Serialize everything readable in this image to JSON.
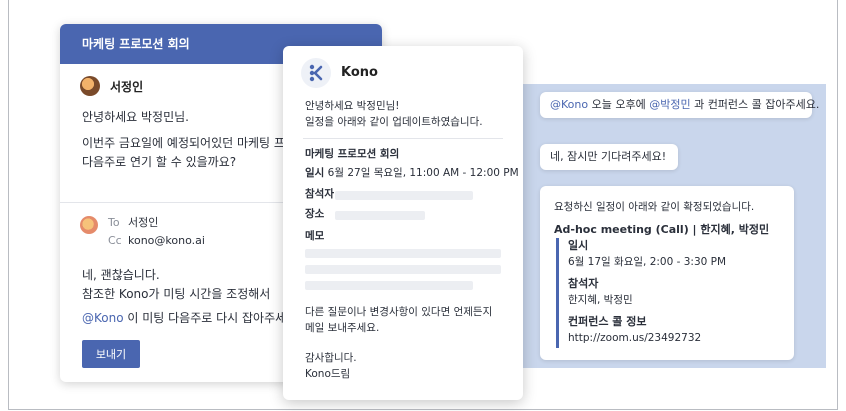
{
  "email": {
    "header_title": "마케팅 프로모션 회의",
    "sender_name": "서정인",
    "body_line1": "안녕하세요 박정민님.",
    "body_line2": "이번주 금요일에 예정되어있던 마케팅 프",
    "body_line3": "다음주로 연기 할 수 있을까요?",
    "to_label": "To",
    "to_value": "서정인",
    "cc_label": "Cc",
    "cc_value": "kono@kono.ai",
    "reply_line1": "네, 괜찮습니다.",
    "reply_line2": "참조한 Kono가 미팅 시간을 조정해서 ",
    "reply_line3_tail": "이 미팅 다음주로 다시 잡아주세",
    "mention": "@Kono",
    "send_label": "보내기"
  },
  "kono": {
    "app_name": "Kono",
    "greeting": "안녕하세요 박정민님!",
    "update_msg": "일정을 아래와 같이 업데이트하였습니다.",
    "meeting_title": "마케팅 프로모션 회의",
    "date_label": "일시",
    "date_value": "6월 27일 목요일, 11:00 AM - 12:00 PM",
    "attendee_label": "참석자",
    "place_label": "장소",
    "memo_label": "메모",
    "closing_line1": "다른 질문이나 변경사항이 있다면 언제든지",
    "closing_line2": "메일 보내주세요.",
    "thanks": "감사합니다.",
    "sign": "Kono드림"
  },
  "chat": {
    "msg1_mention1": "@Kono",
    "msg1_mid": " 오늘 오후에 ",
    "msg1_mention2": "@박정민",
    "msg1_end": " 과 컨퍼런스 콜 잡아주세요.",
    "msg2": "네, 잠시만 기다려주세요!",
    "confirm_intro": "요청하신 일정이 아래와 같이 확정되었습니다.",
    "confirm_title": "Ad-hoc meeting (Call) | 한지혜, 박정민",
    "date_label": "일시",
    "date_value": "6월 17일 화요일, 2:00 - 3:30 PM",
    "attendee_label": "참석자",
    "attendee_value": "한지혜, 박정민",
    "conf_label": "컨퍼런스 콜 정보",
    "conf_value": "http://zoom.us/23492732"
  },
  "colors": {
    "accent": "#4a66b0",
    "chat_bg": "#c9d6ec"
  }
}
